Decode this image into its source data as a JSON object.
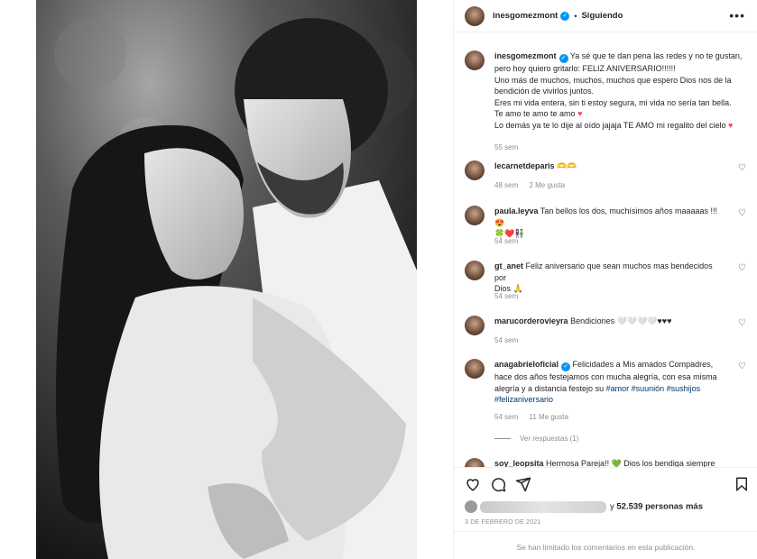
{
  "post": {
    "username": "inesgomezmont",
    "follow_status": "Siguiendo",
    "more_label": "•••"
  },
  "caption": {
    "username": "inesgomezmont",
    "line1": "Ya sé que te dan pena las redes y no te gustan,",
    "line2": "pero hoy quiero gritarlo: FELIZ ANIVERSARIO!!!!!!",
    "line3": "Uno más de muchos, muchos, muchos que espero Dios nos de la",
    "line4": "bendición de vivirlos juntos.",
    "line5": "Eres mi vida entera, sin ti estoy segura, mi vida no sería tan bella.",
    "line6": "Te amo te amo te amo",
    "line7": "Lo demás ya te lo dije al oído jajaja TE AMO mi regalito del cielo",
    "time": "55 sem"
  },
  "comments": [
    {
      "username": "lecarnetdeparis",
      "text": "🫶🫶",
      "time": "48 sem",
      "likes": "2 Me gusta"
    },
    {
      "username": "paula.leyva",
      "text": "Tan bellos los dos, muchísimos años maaaaas !!! 😍",
      "text2": "🍀❤️👫",
      "time": "54 sem"
    },
    {
      "username": "gt_anet",
      "text": "Feliz aniversario que sean muchos mas bendecidos por",
      "text2": "Dios 🙏",
      "time": "54 sem"
    },
    {
      "username": "marucorderovieyra",
      "text": "Bendiciones 🤍🤍🤍🤍♥♥♥",
      "time": "54 sem"
    },
    {
      "username": "anagabrieloficial",
      "text": "Felicidades a Mis amados Compadres,",
      "text2": "hace dos años festejamos con mucha alegría, con esa misma",
      "text3": "alegría y a distancia festejo su",
      "tags": "#amor #suunión #sushijos",
      "tags2": "#felizaniversario",
      "time": "54 sem",
      "likes": "11 Me gusta"
    }
  ],
  "view_replies": "Ver respuestas (1)",
  "partial_comment": {
    "username": "soy_leopsita",
    "text": "Hermosa Pareja!! 💚 Dios los bendiga siempre"
  },
  "likes": {
    "suffix": "y",
    "count": "52.539 personas",
    "label": "más"
  },
  "date": "3 DE FEBRERO DE 2021",
  "comments_limited": "Se han limitado los comentarios en esta publicación."
}
